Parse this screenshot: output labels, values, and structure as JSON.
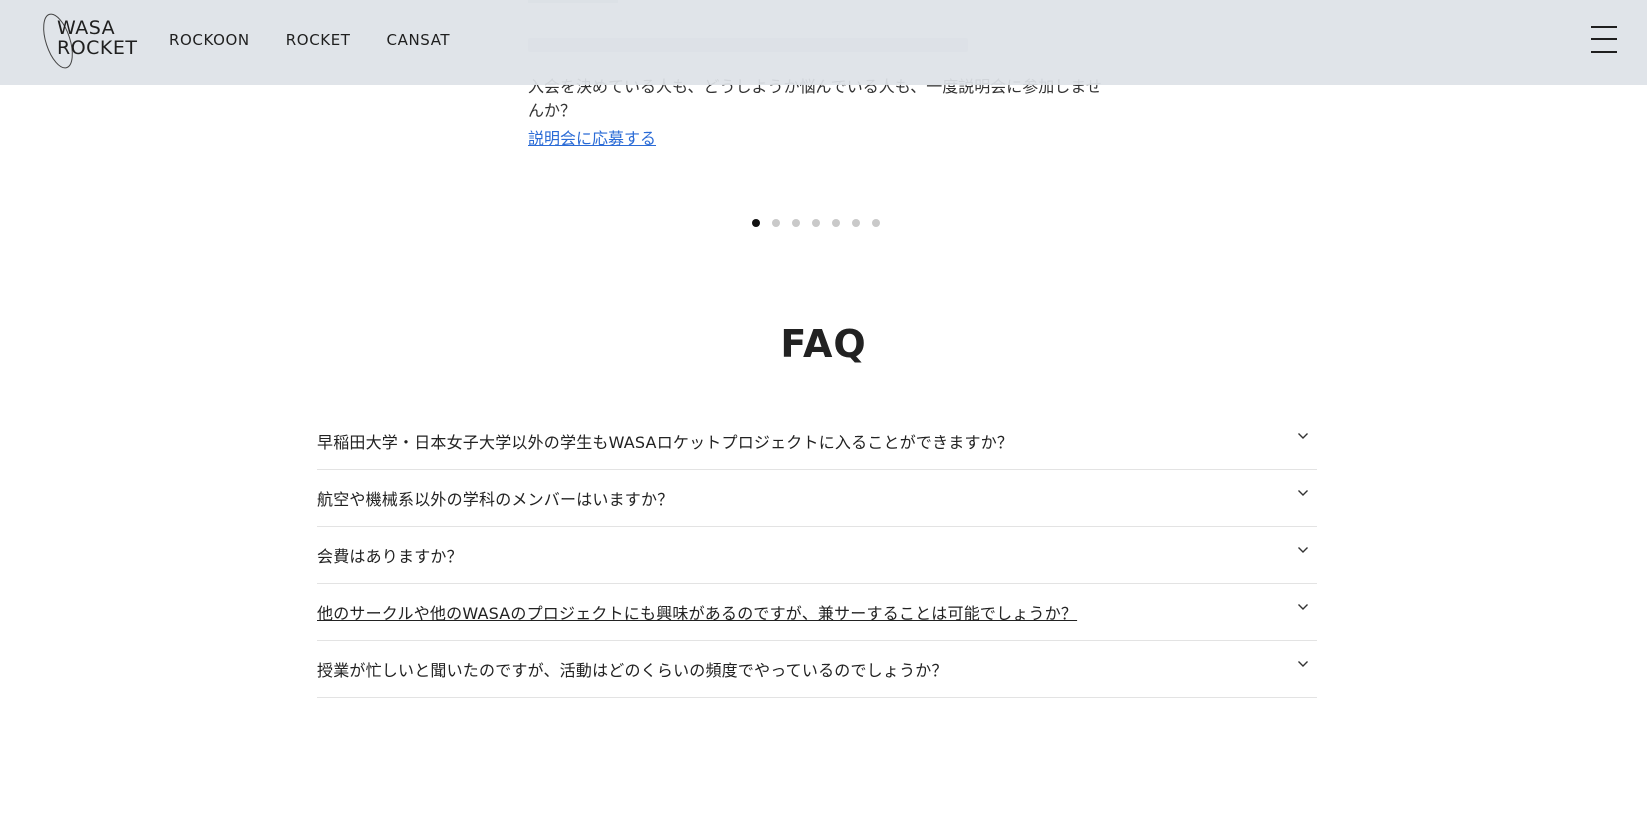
{
  "header": {
    "logo": {
      "line1": "WASA",
      "line2": "ROCKET"
    },
    "nav": [
      "ROCKOON",
      "ROCKET",
      "CANSAT"
    ],
    "menu_icon": "hamburger-icon"
  },
  "intro": {
    "line1": "入会を決めている人も、どうしようか悩んでいる人も、一度説明会に参加しませ",
    "line2": "んか？",
    "link": "説明会に応募する"
  },
  "carousel": {
    "total_dots": 7,
    "active_index": 0
  },
  "faq": {
    "title": "FAQ",
    "items": [
      "早稲田大学・日本女子大学以外の学生もWASAロケットプロジェクトに入ることができますか？",
      "航空や機械系以外の学科のメンバーはいますか？",
      "会費はありますか？",
      "他のサークルや他のWASAのプロジェクトにも興味があるのですが、兼サーすることは可能でしょうか？",
      "授業が忙しいと聞いたのですが、活動はどのくらいの頻度でやっているのでしょうか？"
    ]
  },
  "colors": {
    "header_bg": "#dee2e7",
    "link": "#2a6bd6",
    "dot_active": "#111111",
    "dot_inactive": "#c9c9c9"
  }
}
